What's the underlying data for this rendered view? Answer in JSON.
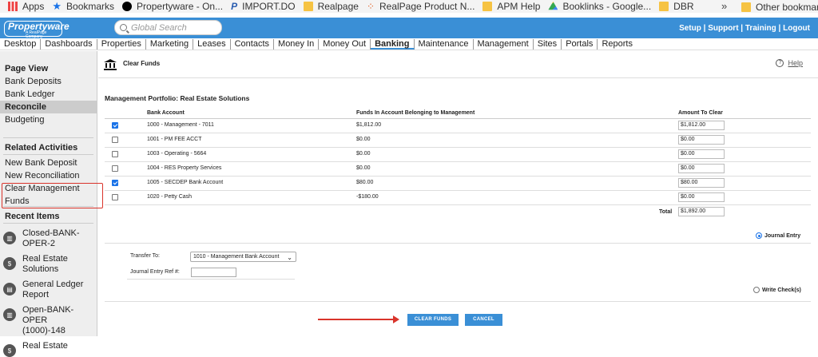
{
  "bookmarks": {
    "items": [
      {
        "label": "Apps",
        "icon": "apps-grid-icon"
      },
      {
        "label": "Bookmarks",
        "icon": "star-icon"
      },
      {
        "label": "Propertyware - On...",
        "icon": "black-circle-icon"
      },
      {
        "label": "IMPORT.DO",
        "icon": "p-logo-icon"
      },
      {
        "label": "Realpage",
        "icon": "folder-icon"
      },
      {
        "label": "RealPage Product N...",
        "icon": "realpage-dots-icon"
      },
      {
        "label": "APM Help",
        "icon": "folder-icon"
      },
      {
        "label": "Booklinks - Google...",
        "icon": "google-drive-icon"
      },
      {
        "label": "DBR",
        "icon": "folder-icon"
      }
    ],
    "more": "»",
    "other": "Other bookmarks"
  },
  "header": {
    "logo_text": "Propertyware",
    "logo_sub": "A RealPage Company",
    "search_placeholder": "Global Search",
    "links": "Setup | Support | Training | Logout"
  },
  "nav": {
    "items": [
      "Desktop",
      "Dashboards",
      "Properties",
      "Marketing",
      "Leases",
      "Contacts",
      "Money In",
      "Money Out",
      "Banking",
      "Maintenance",
      "Management",
      "Sites",
      "Portals",
      "Reports"
    ],
    "active": "Banking"
  },
  "sidebar": {
    "page_view_title": "Page View",
    "page_view": [
      "Bank Deposits",
      "Bank Ledger",
      "Reconcile",
      "Budgeting"
    ],
    "related_title": "Related Activities",
    "related": [
      "New Bank Deposit",
      "New Reconciliation",
      "Clear Management Funds"
    ],
    "recent_title": "Recent Items",
    "recent": [
      {
        "label": "Closed-BANK-OPER-2",
        "icon": "bank-icon"
      },
      {
        "label": "Real Estate Solutions",
        "icon": "dollar-icon"
      },
      {
        "label": "General Ledger Report",
        "icon": "chart-icon"
      },
      {
        "label": "Open-BANK-OPER (1000)-148",
        "icon": "bank-icon"
      },
      {
        "label": "Real Estate",
        "icon": "dollar-icon"
      }
    ]
  },
  "page": {
    "title": "Clear Funds",
    "help": "Help",
    "section_title": "Management Portfolio: Real Estate Solutions",
    "columns": {
      "account": "Bank Account",
      "funds": "Funds In Account Belonging to Management",
      "amount": "Amount To Clear"
    },
    "rows": [
      {
        "checked": true,
        "account": "1000 - Management - 7011",
        "funds": "$1,812.00",
        "amount": "$1,812.00"
      },
      {
        "checked": false,
        "account": "1001 - PM FEE ACCT",
        "funds": "$0.00",
        "amount": "$0.00"
      },
      {
        "checked": false,
        "account": "1003 - Operating - 5664",
        "funds": "$0.00",
        "amount": "$0.00"
      },
      {
        "checked": false,
        "account": "1004 - RES Property Services",
        "funds": "$0.00",
        "amount": "$0.00"
      },
      {
        "checked": true,
        "account": "1005 - SECDEP Bank Account",
        "funds": "$80.00",
        "amount": "$80.00"
      },
      {
        "checked": false,
        "account": "1020 - Petty Cash",
        "funds": "-$180.00",
        "amount": "$0.00"
      }
    ],
    "total_label": "Total",
    "total_value": "$1,892.00",
    "journal_entry_label": "Journal Entry",
    "transfer_to_label": "Transfer To:",
    "transfer_to_value": "1010 - Management Bank Account",
    "je_ref_label": "Journal Entry Ref #:",
    "je_ref_value": "",
    "write_checks_label": "Write Check(s)",
    "clear_button": "CLEAR FUNDS",
    "cancel_button": "CANCEL"
  },
  "colors": {
    "header_blue": "#3a8fd6",
    "annotation_red": "#d9342b"
  }
}
